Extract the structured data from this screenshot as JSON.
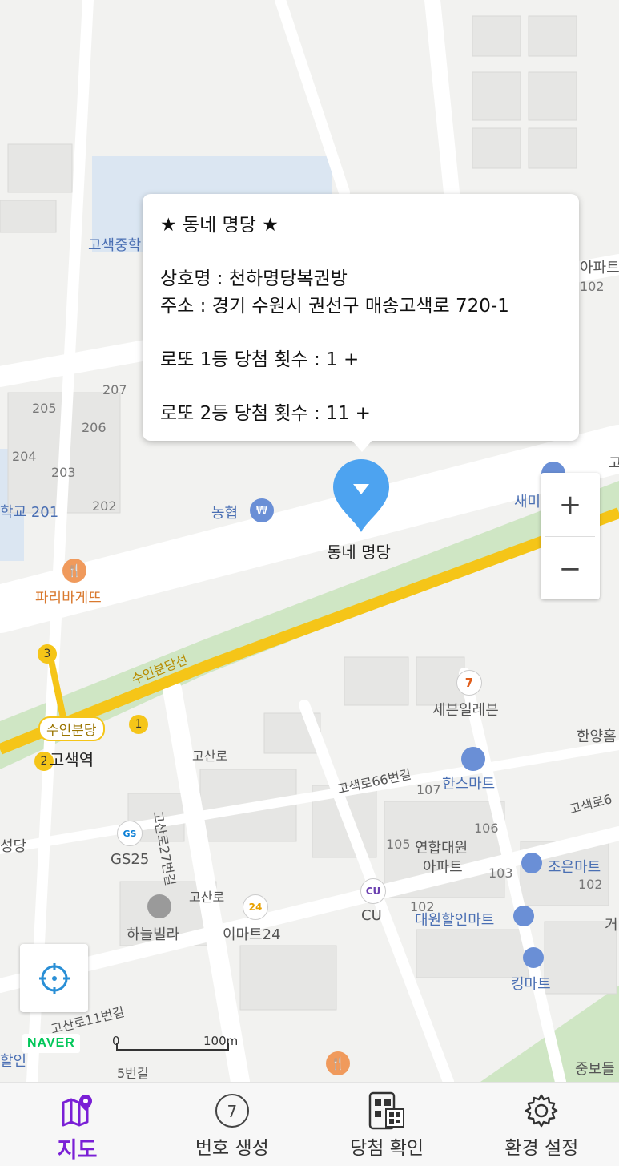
{
  "popup": {
    "title": "★ 동네 명당 ★",
    "shop": "상호명 : 천하명당복권방",
    "address": "주소 : 경기 수원시 권선구 매송고색로 720-1",
    "lotto1": "로또 1등 당첨 횟수 :  1 +",
    "lotto2": "로또 2등 당첨 횟수 :  11 +"
  },
  "marker": {
    "label": "동네 명당",
    "color": "#4da3f0"
  },
  "map_labels": {
    "school_top": "고색중학",
    "apartment_tr": "아파트",
    "n102_tr": "102",
    "n207": "207",
    "n205": "205",
    "n206": "206",
    "n204": "204",
    "n203": "203",
    "n201": "학교 201",
    "n202": "202",
    "nonghyup": "농협",
    "saemi": "새미",
    "paris": "파리바게뜨",
    "suin_line": "수인분당선",
    "suin_badge": "수인분당",
    "gosaek_station": "고색역",
    "seven": "세븐일레븐",
    "hanyang": "한양홈",
    "gosan_ro": "고산로",
    "gosaek66": "고색로66번길",
    "n107": "107",
    "hans_mart": "한스마트",
    "gosaek_ro_r": "고색로6",
    "gosan27": "고산로27번길",
    "n106": "106",
    "n105": "105",
    "yeonhap": "연합대원",
    "yeonhap2": "아파트",
    "joeun": "조은마트",
    "n103": "103",
    "n102_r": "102",
    "seongdang": "성당",
    "gs25": "GS25",
    "gosan_ro2": "고산로",
    "haneul": "하늘빌라",
    "emart24": "이마트24",
    "cu": "CU",
    "n102_b": "102",
    "daewon": "대원할인마트",
    "geo": "거",
    "king": "킹마트",
    "gosan11": "고산로11번길",
    "n_5gil": "5번길",
    "halin": "할인",
    "jungbo": "중보들",
    "go_r": "고"
  },
  "map_logo": "NAVER",
  "scale": {
    "zero": "0",
    "dist": "100m"
  },
  "zoom": {
    "plus": "+",
    "minus": "−"
  },
  "station_numbers": {
    "line3": "3",
    "line1": "1",
    "line2": "2"
  },
  "nav": [
    {
      "label": "지도",
      "icon": "map-pin-icon",
      "active": true
    },
    {
      "label": "번호 생성",
      "icon": "lotto-ball-icon",
      "badge": "7"
    },
    {
      "label": "당첨 확인",
      "icon": "qr-phone-icon"
    },
    {
      "label": "환경 설정",
      "icon": "gear-icon"
    }
  ],
  "colors": {
    "accent": "#7a1fd6",
    "subway": "#f5c518",
    "park": "#c9e8c0",
    "water": "#cfe0f3"
  }
}
